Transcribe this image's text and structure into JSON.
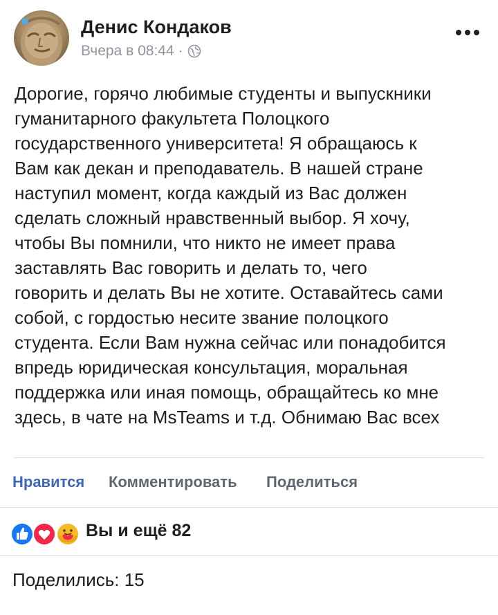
{
  "post": {
    "author": "Денис Кондаков",
    "timestamp": "Вчера в 08:44",
    "separator": "·",
    "privacy_icon": "globe-icon",
    "more_icon": "more-horizontal-icon",
    "text_lines": [
      "Дорогие, горячо любимые студенты и выпускники",
      "гуманитарного факультета Полоцкого",
      "государственного университета! Я обращаюсь к",
      "Вам как декан и преподаватель. В нашей стране",
      "наступил момент, когда каждый из Вас должен",
      "сделать сложный нравственный выбор. Я хочу,",
      "чтобы Вы помнили, что никто не имеет права",
      "заставлять Вас говорить и делать то, чего",
      "говорить и делать Вы не хотите. Оставайтесь сами",
      "собой, с гордостью несите звание полоцкого",
      "студента. Если Вам нужна сейчас или понадобится",
      "впредь юридическая консультация, моральная",
      "поддержка или иная помощь, обращайтесь ко мне",
      "здесь, в чате на MsTeams и т.д. Обнимаю Вас всех"
    ]
  },
  "actions": {
    "like": "Нравится",
    "comment": "Комментировать",
    "share": "Поделиться"
  },
  "reactions": {
    "icons": [
      "like-reaction-icon",
      "love-reaction-icon",
      "care-reaction-icon"
    ],
    "summary": "Вы и ещё 82"
  },
  "shares": {
    "label": "Поделились: 15"
  },
  "colors": {
    "accent": "#4267b2",
    "like": "#1877f2",
    "love": "#f0284a",
    "care": "#f7b928",
    "muted": "#90949c",
    "text": "#1c1e21"
  }
}
